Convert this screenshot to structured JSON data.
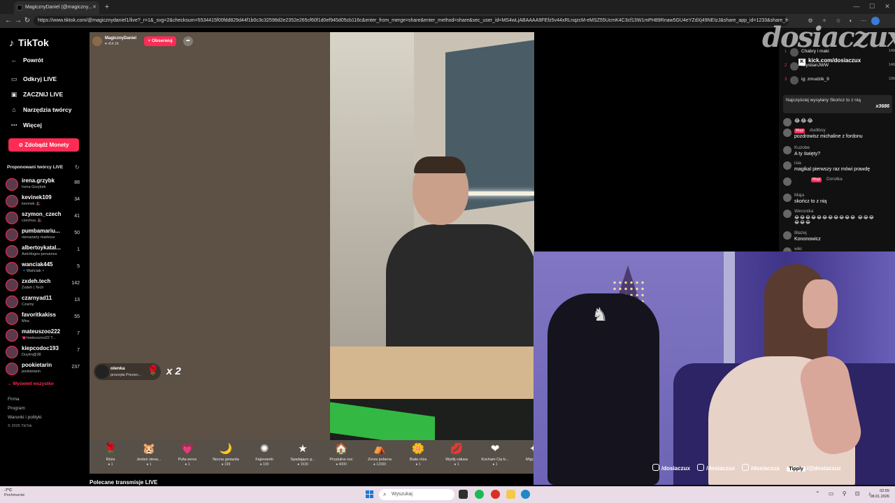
{
  "browser": {
    "tab_title": "MagicznyDaniel (@magiczny...",
    "url": "https://www.tiktok.com/@magicznydaniel1/live?_r=1&_svg=2&checksum=5534415f00fdd829d44f1b0c3c32598d2e2352e265cf60f1d0ef945d05cb116c&enter_from_merge=share&enter_method=share&sec_user_id=MS4wLjABAAAA9FEfz5v44xRLnqzcM-eMSZ55UcmK4C3cf13W1mPH89Rnaw5GU4eYZdXj49NEIzJ&share_app_id=1233&share_from..."
  },
  "sidebar": {
    "logo": "TikTok",
    "nav": [
      {
        "label": "Powrót",
        "icon": "back-arrow-icon"
      },
      {
        "label": "Odkryj LIVE",
        "icon": "live-tv-icon"
      },
      {
        "label": "ZACZNIJ LIVE",
        "icon": "camera-icon"
      },
      {
        "label": "Narzędzia twórcy",
        "icon": "home-icon"
      },
      {
        "label": "Więcej",
        "icon": "more-dots-icon"
      }
    ],
    "coins_button": "Zdobądź Monety",
    "suggested_title": "Proponowani twórcy LIVE",
    "creators": [
      {
        "name": "irena.grzybk",
        "sub": "Irena Grzybek",
        "count": "88"
      },
      {
        "name": "kevinek109",
        "sub": "kevinek 🎩",
        "count": "34"
      },
      {
        "name": "szymon_czech",
        "sub": "czechuu 🎩",
        "count": "41"
      },
      {
        "name": "pumbamariu...",
        "sub": "nienażarty markosz",
        "count": "50"
      },
      {
        "name": "albertoykatal...",
        "sub": "Astrólogos peruanos",
        "count": "1"
      },
      {
        "name": "wanciak445",
        "sub": "🔹Wańciak🔹",
        "count": "5"
      },
      {
        "name": "zxdeh.tech",
        "sub": "Zxdeh | Tech",
        "count": "142"
      },
      {
        "name": "czarnyad11",
        "sub": "Czarny",
        "count": "13"
      },
      {
        "name": "favoritkakiss",
        "sub": "Mira",
        "count": "55"
      },
      {
        "name": "mateuszoo222",
        "sub": "💗mateuszoo22 T...",
        "count": "7"
      },
      {
        "name": "kiepcodoc193",
        "sub": "Duyên@38",
        "count": "7"
      },
      {
        "name": "pookietarin",
        "sub": "pookietarin",
        "count": "237"
      }
    ],
    "show_all": "Wyświetl wszystko",
    "footer": [
      "Firma",
      "Program",
      "Warunki i polityki"
    ],
    "copyright": "© 2026 TikTok"
  },
  "stream": {
    "host_name": "MagicznyDaniel",
    "host_likes": "♥ 414.1K",
    "follow_label": "+ Obserwuj",
    "gift_notification": {
      "user": "olenka",
      "action": "przesyła Prezen...",
      "count": "x 2"
    },
    "gifts": [
      {
        "name": "Róża",
        "price": "1",
        "icon": "🌹"
      },
      {
        "name": "Jesteś niesa...",
        "price": "1",
        "icon": "🐹"
      },
      {
        "name": "Pufa-serce",
        "price": "1",
        "icon": "💗"
      },
      {
        "name": "Nocna gwiazda",
        "price": "199",
        "icon": "🌙"
      },
      {
        "name": "Fajerwerki",
        "price": "100",
        "icon": "✺"
      },
      {
        "name": "Spadające g...",
        "price": "1530",
        "icon": "★"
      },
      {
        "name": "Przytulna noc",
        "price": "4000",
        "icon": "🏠"
      },
      {
        "name": "Zorza polarna",
        "price": "12000",
        "icon": "⛺"
      },
      {
        "name": "Biała róża",
        "price": "1",
        "icon": "🌼"
      },
      {
        "name": "Wyślij całusa",
        "price": "1",
        "icon": "💋"
      },
      {
        "name": "Kocham Cię b...",
        "price": "1",
        "icon": "❤"
      },
      {
        "name": "Migocz...",
        "price": "",
        "icon": "✦"
      }
    ],
    "recommended": "Polecane transmisje LIVE"
  },
  "chat": {
    "ranking": [
      {
        "num": "1",
        "name": "Chabry i maki",
        "pts": "149"
      },
      {
        "name": "KrystianJWW",
        "num": "2",
        "pts": "146"
      },
      {
        "name": "ig: zmudzik_9",
        "num": "3",
        "pts": "106"
      }
    ],
    "top_gifter_text": "Najczęściej wysyłany Skończ to z nią",
    "top_gifter_count": "x3686",
    "messages": [
      {
        "user": "",
        "badge": "",
        "text": "😂😂😂"
      },
      {
        "user": "dudiboy",
        "badge": "Magi",
        "text": "pozdrowisz michaline z fordonu"
      },
      {
        "user": "Kuzobe",
        "badge": "",
        "text": "A ty święty?"
      },
      {
        "user": "isia",
        "badge": "",
        "text": "magikal pierwszy raz mówi prawdę"
      },
      {
        "user": "Dorotka",
        "badge": "Magi",
        "text": ""
      },
      {
        "user": "Maja",
        "badge": "",
        "text": "skończ to z nią"
      },
      {
        "user": "Weronika",
        "badge": "",
        "text": "😂😂😂😂😂😂😂😂😂😂😂 😂😂😂😂😂😂"
      },
      {
        "user": "Błażej",
        "badge": "",
        "text": "Kononowicz"
      },
      {
        "user": "wiki",
        "badge": "",
        "text": ""
      }
    ]
  },
  "overlay": {
    "watermark": "dosiaczux",
    "kick": "kick.com/dosiaczux",
    "socials": [
      "/dosiaczux",
      "/dosiaczux",
      "/dosiaczux",
      "/@dosiaczux"
    ],
    "tippy_label": "Tipply"
  },
  "taskbar": {
    "weather_temp": "-7°C",
    "weather_desc": "Pochmurnie",
    "search_placeholder": "Wyszukaj",
    "time": "02:55",
    "date": "08.01.2026"
  },
  "colors": {
    "accent": "#fe2c55",
    "stream_bg": "#5f5247",
    "taskbar": "#e9dce6"
  }
}
